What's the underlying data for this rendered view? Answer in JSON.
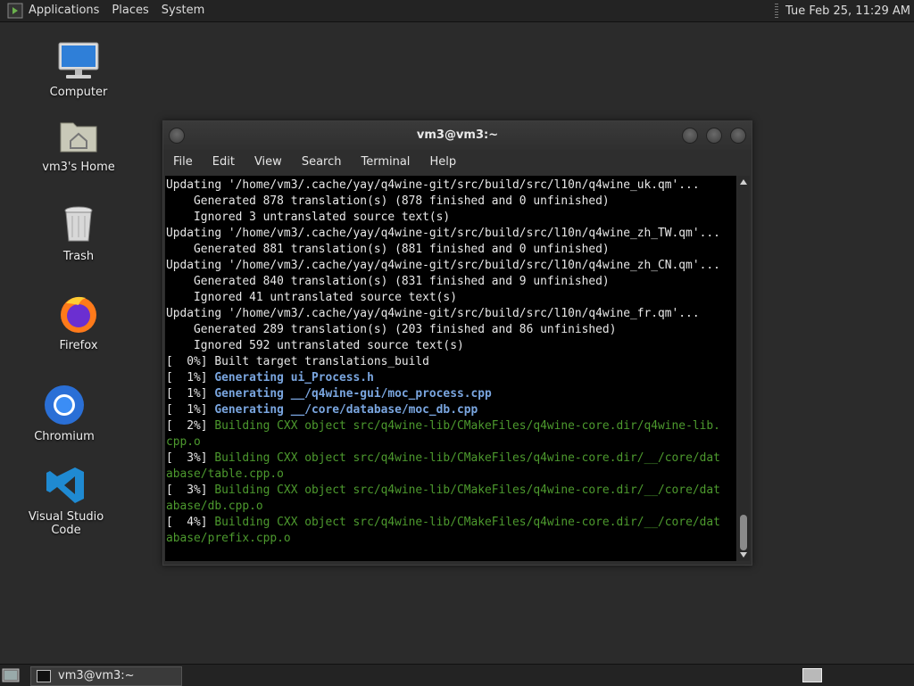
{
  "top_panel": {
    "menu": [
      "Applications",
      "Places",
      "System"
    ],
    "clock": "Tue Feb 25, 11:29 AM"
  },
  "desktop_icons": [
    {
      "label": "Computer",
      "icon": "computer-icon"
    },
    {
      "label": "vm3's Home",
      "icon": "home-folder-icon"
    },
    {
      "label": "Trash",
      "icon": "trash-icon"
    },
    {
      "label": "Firefox",
      "icon": "firefox-icon"
    },
    {
      "label": "Chromium",
      "icon": "chromium-icon"
    },
    {
      "label": "Visual Studio Code",
      "icon": "vscode-icon"
    }
  ],
  "terminal": {
    "title": "vm3@vm3:~",
    "menu": [
      "File",
      "Edit",
      "View",
      "Search",
      "Terminal",
      "Help"
    ],
    "lines": [
      {
        "text": "Updating '/home/vm3/.cache/yay/q4wine-git/src/build/src/l10n/q4wine_uk.qm'..."
      },
      {
        "text": "    Generated 878 translation(s) (878 finished and 0 unfinished)"
      },
      {
        "text": "    Ignored 3 untranslated source text(s)"
      },
      {
        "text": "Updating '/home/vm3/.cache/yay/q4wine-git/src/build/src/l10n/q4wine_zh_TW.qm'..."
      },
      {
        "text": "    Generated 881 translation(s) (881 finished and 0 unfinished)"
      },
      {
        "text": "Updating '/home/vm3/.cache/yay/q4wine-git/src/build/src/l10n/q4wine_zh_CN.qm'..."
      },
      {
        "text": "    Generated 840 translation(s) (831 finished and 9 unfinished)"
      },
      {
        "text": "    Ignored 41 untranslated source text(s)"
      },
      {
        "text": "Updating '/home/vm3/.cache/yay/q4wine-git/src/build/src/l10n/q4wine_fr.qm'..."
      },
      {
        "text": "    Generated 289 translation(s) (203 finished and 86 unfinished)"
      },
      {
        "text": "    Ignored 592 untranslated source text(s)"
      },
      {
        "prefix": "[  0%] ",
        "text": "Built target translations_build"
      },
      {
        "prefix": "[  1%] ",
        "text": "Generating ui_Process.h",
        "style": "blue"
      },
      {
        "prefix": "[  1%] ",
        "text": "Generating __/q4wine-gui/moc_process.cpp",
        "style": "blue"
      },
      {
        "prefix": "[  1%] ",
        "text": "Generating __/core/database/moc_db.cpp",
        "style": "blue"
      },
      {
        "prefix": "[  2%] ",
        "text": "Building CXX object src/q4wine-lib/CMakeFiles/q4wine-core.dir/q4wine-lib.",
        "style": "green"
      },
      {
        "text": "cpp.o",
        "style": "green"
      },
      {
        "prefix": "[  3%] ",
        "text": "Building CXX object src/q4wine-lib/CMakeFiles/q4wine-core.dir/__/core/dat",
        "style": "green"
      },
      {
        "text": "abase/table.cpp.o",
        "style": "green"
      },
      {
        "prefix": "[  3%] ",
        "text": "Building CXX object src/q4wine-lib/CMakeFiles/q4wine-core.dir/__/core/dat",
        "style": "green"
      },
      {
        "text": "abase/db.cpp.o",
        "style": "green"
      },
      {
        "prefix": "[  4%] ",
        "text": "Building CXX object src/q4wine-lib/CMakeFiles/q4wine-core.dir/__/core/dat",
        "style": "green"
      },
      {
        "text": "abase/prefix.cpp.o",
        "style": "green"
      }
    ]
  },
  "taskbar": {
    "window_button": "vm3@vm3:~"
  },
  "colors": {
    "desktop_bg": "#2b2b2b",
    "terminal_bg": "#000000",
    "terminal_fg": "#e8e8e8",
    "build_green": "#4d9a2e",
    "generate_blue": "#7aa6e0"
  }
}
